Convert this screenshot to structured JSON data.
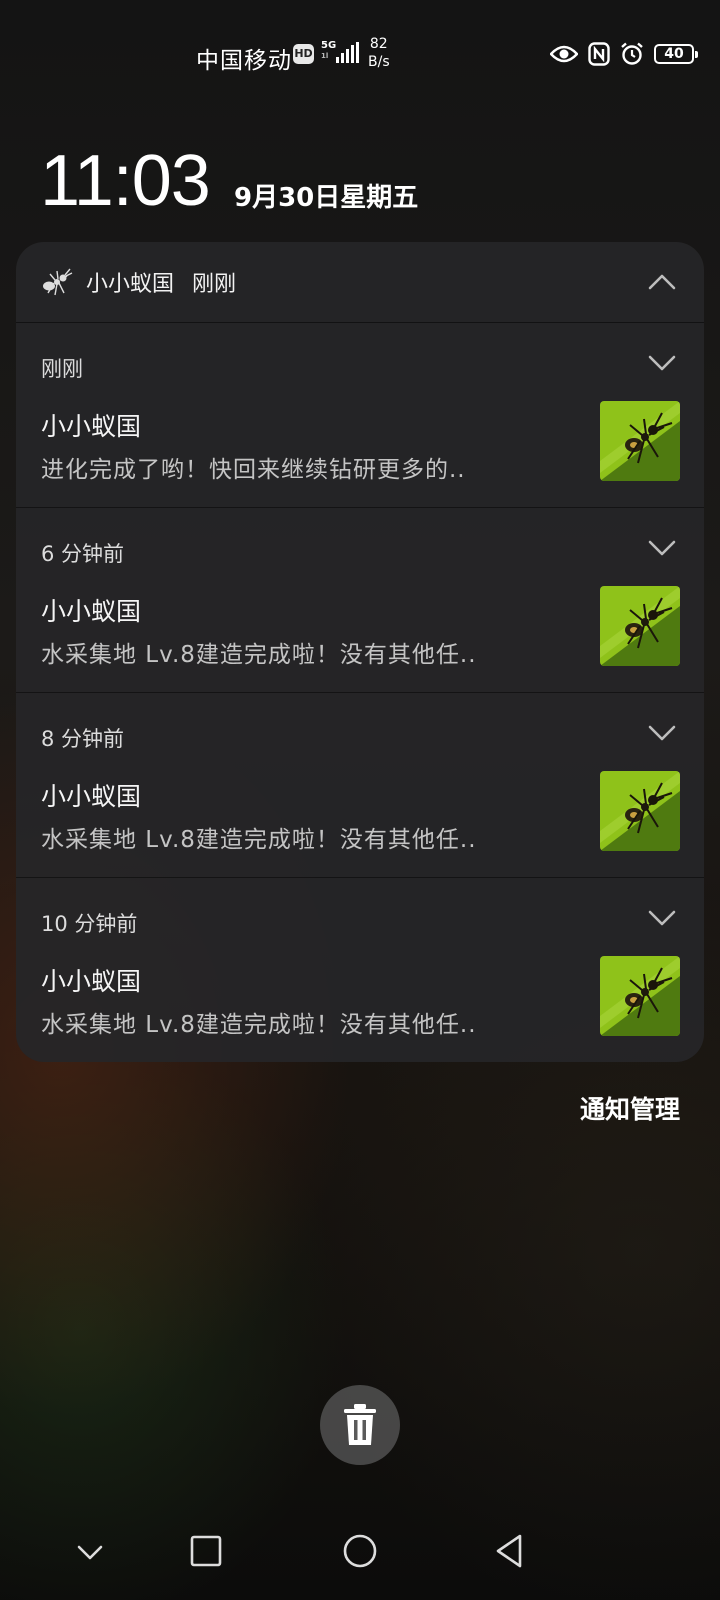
{
  "status_bar": {
    "carrier": "中国移动",
    "hd": "HD",
    "network": "5G",
    "network_sub": "1l",
    "speed_value": "82",
    "speed_unit": "B/s",
    "battery": "40",
    "icons": [
      "eye-icon",
      "nfc-icon",
      "alarm-icon",
      "battery-icon"
    ]
  },
  "lock": {
    "time": "11:03",
    "date": "9月30日星期五"
  },
  "group": {
    "app_name": "小小蚁国",
    "time": "刚刚",
    "notifications": [
      {
        "time": "刚刚",
        "title": "小小蚁国",
        "body": "进化完成了哟！快回来继续钻研更多的.."
      },
      {
        "time": "6 分钟前",
        "title": "小小蚁国",
        "body": "水采集地 Lv.8建造完成啦！没有其他任.."
      },
      {
        "time": "8 分钟前",
        "title": "小小蚁国",
        "body": "水采集地 Lv.8建造完成啦！没有其他任.."
      },
      {
        "time": "10 分钟前",
        "title": "小小蚁国",
        "body": "水采集地 Lv.8建造完成啦！没有其他任.."
      }
    ]
  },
  "actions": {
    "manage": "通知管理"
  },
  "colors": {
    "card_bg": "#262628",
    "thumb_green": "#8fc21a",
    "text_secondary": "#c4c4c4"
  }
}
